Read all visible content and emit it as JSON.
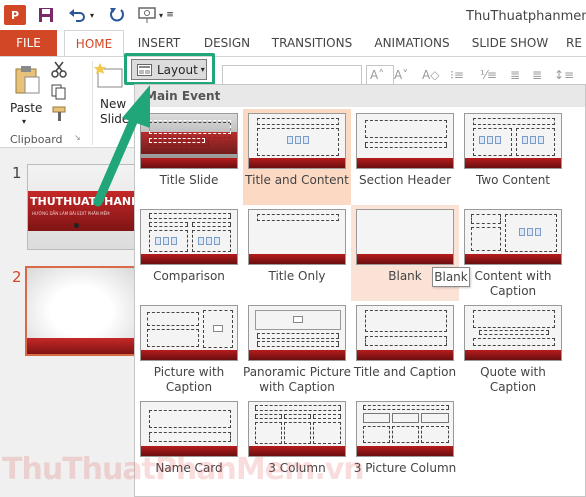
{
  "title_bar": {
    "app_logo": "P",
    "document_title": "ThuThuatphanmem.pp",
    "icons": [
      "save-icon",
      "undo-icon",
      "redo-icon",
      "present-from-start-icon"
    ]
  },
  "tabs": [
    {
      "label": "FILE"
    },
    {
      "label": "HOME"
    },
    {
      "label": "INSERT"
    },
    {
      "label": "DESIGN"
    },
    {
      "label": "TRANSITIONS"
    },
    {
      "label": "ANIMATIONS"
    },
    {
      "label": "SLIDE SHOW"
    },
    {
      "label": "RE"
    }
  ],
  "ribbon": {
    "paste_label": "Paste",
    "clipboard_label": "Clipboard",
    "new_slide_label": "New Slide",
    "layout_label": "Layout"
  },
  "thumbnails": [
    {
      "number": "1",
      "title": "THUTHUATPHANME",
      "subtitle": "HƯỚNG DẪN LÀM BÀI EDIT PHẦN MỀM"
    },
    {
      "number": "2"
    }
  ],
  "gallery": {
    "header": "Main Event",
    "layouts": [
      {
        "label": "Title Slide"
      },
      {
        "label": "Title and Content"
      },
      {
        "label": "Section Header"
      },
      {
        "label": "Two Content"
      },
      {
        "label": "Comparison"
      },
      {
        "label": "Title Only"
      },
      {
        "label": "Blank"
      },
      {
        "label": "Content with Caption"
      },
      {
        "label": "Picture with Caption"
      },
      {
        "label": "Panoramic Picture with Caption"
      },
      {
        "label": "Title and Caption"
      },
      {
        "label": "Quote with Caption"
      },
      {
        "label": "Name Card"
      },
      {
        "label": "3 Column"
      },
      {
        "label": "3 Picture Column"
      }
    ],
    "tooltip": "Blank"
  },
  "colors": {
    "accent": "#d24726",
    "highlight": "#21a67a",
    "selected_cell": "#fcd9c3",
    "slide_band": "#b71c1c"
  },
  "watermark": "ThuThuatPhanMem.vn"
}
